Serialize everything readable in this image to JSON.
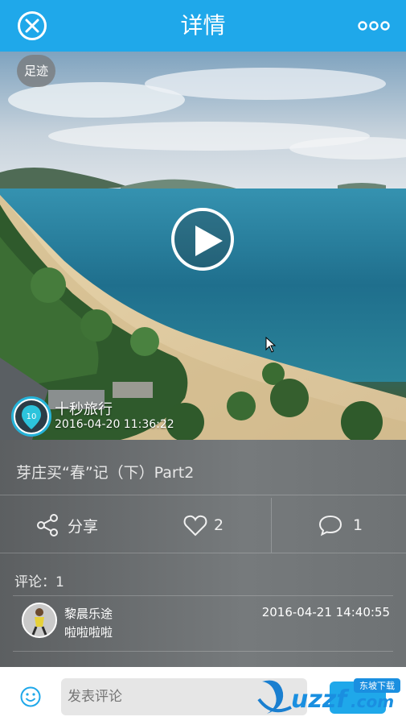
{
  "header": {
    "title": "详情",
    "close_icon": "close-icon",
    "more_icon": "more-icon"
  },
  "video": {
    "footprint_label": "足迹",
    "author": {
      "name": "十秒旅行",
      "time": "2016-04-20 11:36:22"
    }
  },
  "post": {
    "title": "芽庄买“春”记（下）Part2"
  },
  "actions": {
    "share_label": "分享",
    "like_count": "2",
    "comment_count": "1"
  },
  "comments": {
    "header": "评论：1",
    "items": [
      {
        "name": "黎晨乐途",
        "text": "啦啦啦啦",
        "time": "2016-04-21 14:40:55"
      }
    ]
  },
  "bottom": {
    "placeholder": "发表评论",
    "watermark_text": "uzzf.com",
    "watermark_sub": "东坡下载"
  },
  "colors": {
    "accent": "#1fa8ea",
    "white": "#ffffff"
  }
}
